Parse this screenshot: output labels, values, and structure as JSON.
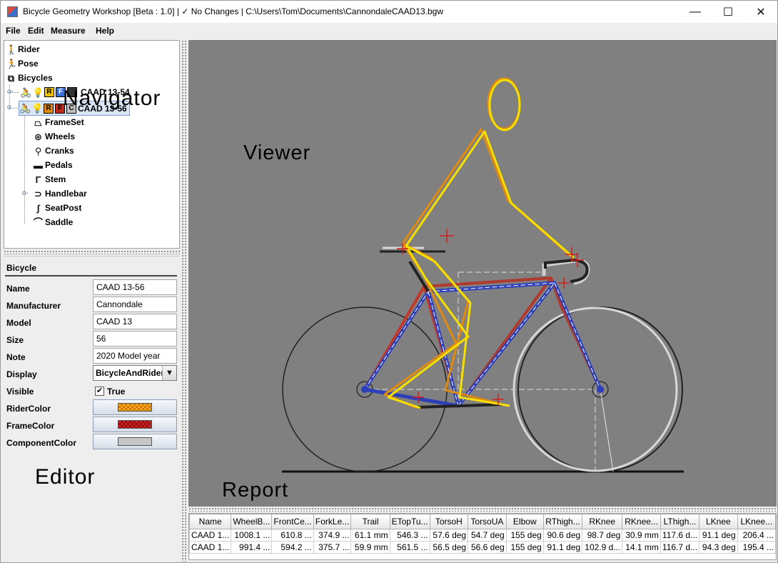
{
  "window": {
    "title": "Bicycle Geometry Workshop [Beta : 1.0]  | ✓ No Changes | C:\\Users\\Tom\\Documents\\CannondaleCAAD13.bgw",
    "minimize_glyph": "—",
    "maximize_glyph": "☐",
    "close_glyph": "✕"
  },
  "menu": [
    "File",
    "Edit",
    "Measure",
    "Help"
  ],
  "navigator": {
    "overlay_label": "Navigator",
    "root_items": [
      {
        "label": "Rider",
        "icon": "rider-icon",
        "glyph": "🚶"
      },
      {
        "label": "Pose",
        "icon": "pose-icon",
        "glyph": "🏃"
      },
      {
        "label": "Bicycles",
        "icon": "bicycles-icon",
        "glyph": "⧉"
      }
    ],
    "bicycles": [
      {
        "label": "CAAD 13-54",
        "badges": [
          "R",
          "F",
          ""
        ],
        "badge_colors": [
          "#f2c200",
          "#3a6fd8",
          "#333333"
        ],
        "expanded": false
      },
      {
        "label": "CAAD 13-56",
        "badges": [
          "R",
          "F",
          "C"
        ],
        "badge_colors": [
          "#e08a10",
          "#c02a1a",
          "#c0c0c0"
        ],
        "expanded": true,
        "selected": true
      }
    ],
    "components": [
      {
        "label": "FrameSet",
        "icon": "frameset-icon",
        "glyph": "⏢"
      },
      {
        "label": "Wheels",
        "icon": "wheel-icon",
        "glyph": "⊛"
      },
      {
        "label": "Cranks",
        "icon": "crank-icon",
        "glyph": "⚲"
      },
      {
        "label": "Pedals",
        "icon": "pedal-icon",
        "glyph": "▬"
      },
      {
        "label": "Stem",
        "icon": "stem-icon",
        "glyph": "Γ"
      },
      {
        "label": "Handlebar",
        "icon": "handlebar-icon",
        "glyph": "⊃"
      },
      {
        "label": "SeatPost",
        "icon": "seatpost-icon",
        "glyph": "ʃ"
      },
      {
        "label": "Saddle",
        "icon": "saddle-icon",
        "glyph": "⌒"
      }
    ]
  },
  "editor": {
    "overlay_label": "Editor",
    "section_title": "Bicycle",
    "fields": [
      {
        "label": "Name",
        "value": "CAAD 13-56"
      },
      {
        "label": "Manufacturer",
        "value": "Cannondale"
      },
      {
        "label": "Model",
        "value": "CAAD 13"
      },
      {
        "label": "Size",
        "value": "56"
      },
      {
        "label": "Note",
        "value": "2020 Model year"
      }
    ],
    "display": {
      "label": "Display",
      "value": "BicycleAndRider",
      "arrow": "▼"
    },
    "visible": {
      "label": "Visible",
      "value": "True",
      "check": "✔"
    },
    "colors": [
      {
        "label": "RiderColor",
        "color": "#f5a623"
      },
      {
        "label": "FrameColor",
        "color": "#cc2020"
      },
      {
        "label": "ComponentColor",
        "color": "#c6c6c6"
      }
    ]
  },
  "viewer": {
    "overlay_label": "Viewer",
    "background": "#808080"
  },
  "report": {
    "overlay_label": "Report",
    "columns": [
      "Name",
      "WheelB...",
      "FrontCe...",
      "ForkLe...",
      "Trail",
      "ETopTu...",
      "TorsoH",
      "TorsoUA",
      "Elbow",
      "RThigh...",
      "RKnee",
      "RKnee...",
      "LThigh...",
      "LKnee",
      "LKnee..."
    ],
    "rows": [
      [
        "CAAD 1...",
        "1008.1 ...",
        "610.8 ...",
        "374.9 ...",
        "61.1 mm",
        "546.3 ...",
        "57.6 deg",
        "54.7 deg",
        "155 deg",
        "90.6 deg",
        "98.7 deg",
        "30.9 mm",
        "117.6 d...",
        "91.1 deg",
        "206.4 ..."
      ],
      [
        "CAAD 1...",
        "991.4 ...",
        "594.2 ...",
        "375.7 ...",
        "59.9 mm",
        "561.5 ...",
        "56.5 deg",
        "56.6 deg",
        "155 deg",
        "91.1 deg",
        "102.9 d...",
        "14.1 mm",
        "116.7 d...",
        "94.3 deg",
        "195.4 ..."
      ]
    ]
  }
}
